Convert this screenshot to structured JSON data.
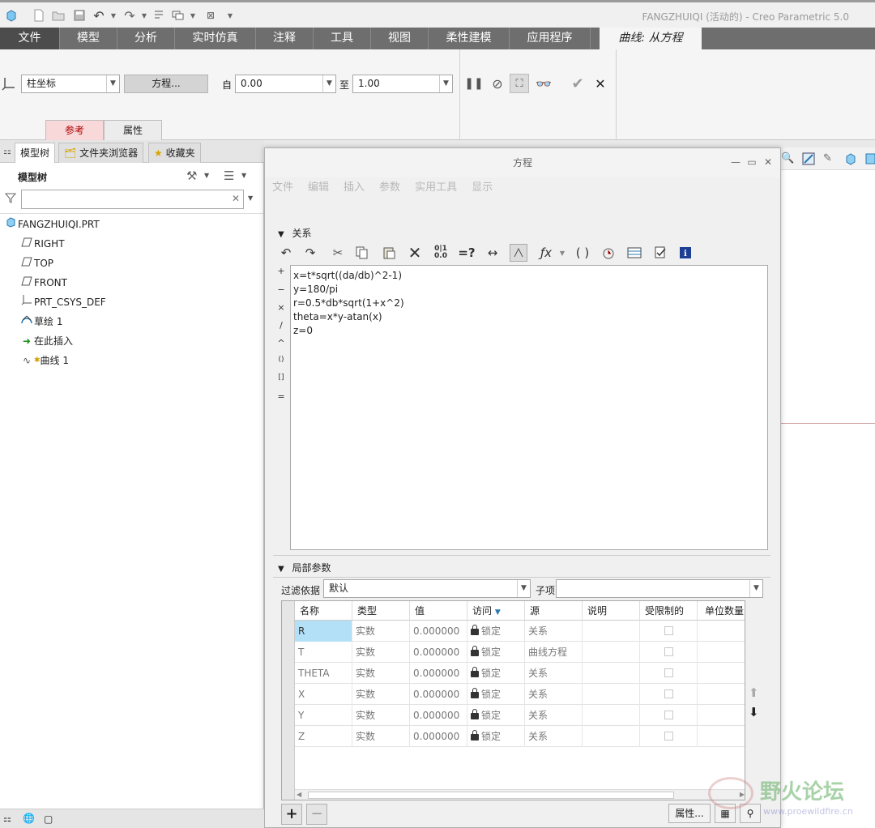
{
  "window": {
    "title": "FANGZHUIQI (活动的) - Creo Parametric 5.0"
  },
  "ribbon_tabs": [
    "文件",
    "模型",
    "分析",
    "实时仿真",
    "注释",
    "工具",
    "视图",
    "柔性建模",
    "应用程序",
    "曲线: 从方程"
  ],
  "ribbon": {
    "coord_type": "柱坐标",
    "equation_button": "方程...",
    "from_label": "自",
    "from_value": "0.00",
    "to_label": "至",
    "to_value": "1.00",
    "subtabs": [
      "参考",
      "属性"
    ]
  },
  "left_panel": {
    "tabs": [
      "模型树",
      "文件夹浏览器",
      "收藏夹"
    ],
    "header": "模型树",
    "tree": [
      {
        "label": "FANGZHUIQI.PRT",
        "icon": "part-icon"
      },
      {
        "label": "RIGHT",
        "icon": "datum-plane-icon"
      },
      {
        "label": "TOP",
        "icon": "datum-plane-icon"
      },
      {
        "label": "FRONT",
        "icon": "datum-plane-icon"
      },
      {
        "label": "PRT_CSYS_DEF",
        "icon": "csys-icon"
      },
      {
        "label": "草绘 1",
        "icon": "sketch-icon"
      },
      {
        "label": "在此插入",
        "icon": "insert-arrow-icon"
      },
      {
        "label": "曲线 1",
        "icon": "curve-icon"
      }
    ]
  },
  "dialog": {
    "title": "方程",
    "menu": [
      "文件",
      "编辑",
      "插入",
      "参数",
      "实用工具",
      "显示"
    ],
    "relations_header": "关系",
    "equations": [
      "x=t*sqrt((da/db)^2-1)",
      "y=180/pi",
      "r=0.5*db*sqrt(1+x^2)",
      "theta=x*y-atan(x)",
      "z=0"
    ],
    "operators": [
      "+",
      "−",
      "×",
      "/",
      "^",
      "()",
      "[]",
      "="
    ],
    "local_params_header": "局部参数",
    "filter_label": "过滤依据",
    "filter_value": "默认",
    "subitem_label": "子项",
    "columns": [
      "名称",
      "类型",
      "值",
      "访问",
      "源",
      "说明",
      "受限制的",
      "单位数量"
    ],
    "rows": [
      {
        "name": "R",
        "type": "实数",
        "value": "0.000000",
        "access": "锁定",
        "source": "关系"
      },
      {
        "name": "T",
        "type": "实数",
        "value": "0.000000",
        "access": "锁定",
        "source": "曲线方程"
      },
      {
        "name": "THETA",
        "type": "实数",
        "value": "0.000000",
        "access": "锁定",
        "source": "关系"
      },
      {
        "name": "X",
        "type": "实数",
        "value": "0.000000",
        "access": "锁定",
        "source": "关系"
      },
      {
        "name": "Y",
        "type": "实数",
        "value": "0.000000",
        "access": "锁定",
        "source": "关系"
      },
      {
        "name": "Z",
        "type": "实数",
        "value": "0.000000",
        "access": "锁定",
        "source": "关系"
      }
    ],
    "properties_button": "属性..."
  },
  "watermark": {
    "text": "野火论坛",
    "url": "www.proewildfire.cn"
  },
  "colors": {
    "tab_bar": "#6e6e6e",
    "active_subtab": "#f9d8da",
    "selected_cell": "#b3e0f7",
    "info_blue": "#1c3f94"
  }
}
